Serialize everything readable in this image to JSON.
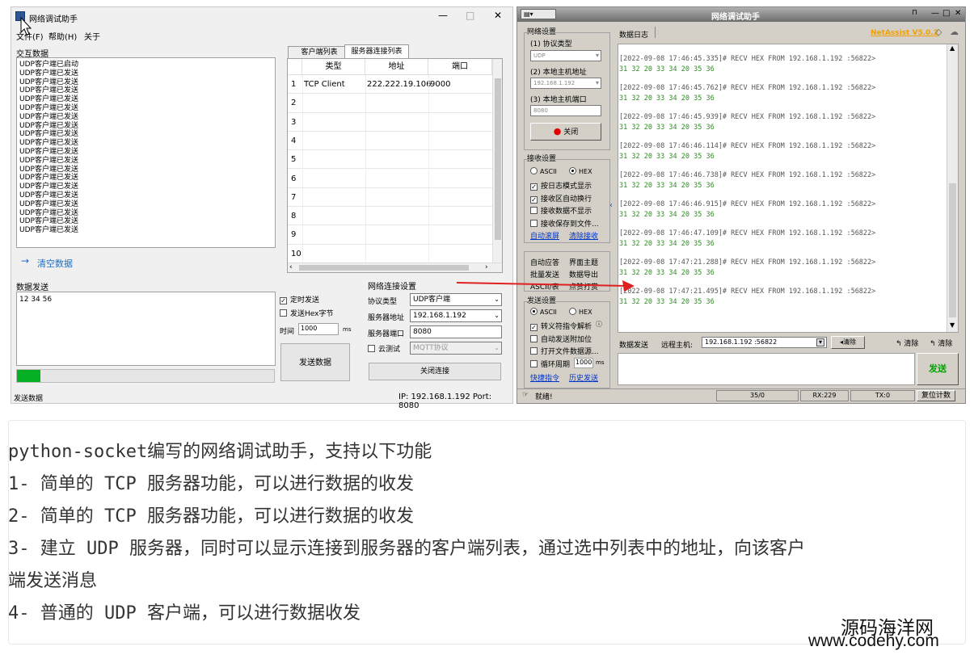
{
  "left_app": {
    "title": "网络调试助手",
    "window_controls": [
      "—",
      "□",
      "✕"
    ],
    "menu": [
      "文件(F)",
      "帮助(H)",
      "关于"
    ],
    "interaction_label": "交互数据",
    "interaction_lines": [
      "UDP客户端已启动",
      "UDP客户端已发送",
      "UDP客户端已发送",
      "UDP客户端已发送",
      "UDP客户端已发送",
      "UDP客户端已发送",
      "UDP客户端已发送",
      "UDP客户端已发送",
      "UDP客户端已发送",
      "UDP客户端已发送",
      "UDP客户端已发送",
      "UDP客户端已发送",
      "UDP客户端已发送",
      "UDP客户端已发送",
      "UDP客户端已发送",
      "UDP客户端已发送",
      "UDP客户端已发送",
      "UDP客户端已发送",
      "UDP客户端已发送",
      "UDP客户端已发送"
    ],
    "tabs": [
      "客户端列表",
      "服务器连接列表"
    ],
    "table_headers": [
      "类型",
      "地址",
      "端口"
    ],
    "rows": [
      {
        "n": "1",
        "type": "TCP Client",
        "addr": "222.222.19.106",
        "port": "9000"
      },
      {
        "n": "2",
        "type": "",
        "addr": "",
        "port": ""
      },
      {
        "n": "3",
        "type": "",
        "addr": "",
        "port": ""
      },
      {
        "n": "4",
        "type": "",
        "addr": "",
        "port": ""
      },
      {
        "n": "5",
        "type": "",
        "addr": "",
        "port": ""
      },
      {
        "n": "6",
        "type": "",
        "addr": "",
        "port": ""
      },
      {
        "n": "7",
        "type": "",
        "addr": "",
        "port": ""
      },
      {
        "n": "8",
        "type": "",
        "addr": "",
        "port": ""
      },
      {
        "n": "9",
        "type": "",
        "addr": "",
        "port": ""
      },
      {
        "n": "10",
        "type": "",
        "addr": "",
        "port": ""
      }
    ],
    "clear_label": "清空数据",
    "send_label": "数据发送",
    "send_text": "12 34 56",
    "timed_send": "定时发送",
    "hex_send": "发送Hex字节",
    "time_label": "时间",
    "time_value": "1000",
    "time_unit": "ms",
    "send_button": "发送数据",
    "progress": 0.09,
    "net_settings_label": "网络连接设置",
    "protocol_label": "协议类型",
    "protocol_value": "UDP客户端",
    "server_addr_label": "服务器地址",
    "server_addr_value": "192.168.1.192",
    "server_port_label": "服务器端口",
    "server_port_value": "8080",
    "cloud_test": "云测试",
    "mqtt_value": "MQTT协议",
    "close_conn": "关闭连接",
    "status_left": "发送数据",
    "status_right": "IP: 192.168.1.192  Port: 8080"
  },
  "right_app": {
    "title": "网络调试助手",
    "window_controls": [
      "—",
      "□",
      "✕"
    ],
    "net_settings": "网络设置",
    "protocol_label": "(1) 协议类型",
    "protocol_value": "UDP",
    "host_label": "(2) 本地主机地址",
    "host_value": "192.168.1.192",
    "port_label": "(3) 本地主机端口",
    "port_value": "8080",
    "close_btn": "关闭",
    "recv_settings": "接收设置",
    "ascii": "ASCII",
    "hex": "HEX",
    "recv_opts": [
      "按日志模式显示",
      "接收区自动换行",
      "接收数据不显示",
      "接收保存到文件..."
    ],
    "recv_checked": [
      true,
      true,
      false,
      false
    ],
    "auto_scroll": "自动滚屏",
    "clear_recv": "清除接收",
    "misc_links": [
      "自动应答",
      "界面主题",
      "批量发送",
      "数据导出",
      "ASCII/表",
      "点赞打赏"
    ],
    "send_settings": "发送设置",
    "send_opts": [
      "转义符指令解析",
      "自动发送附加位",
      "打开文件数据源...",
      "循环周期"
    ],
    "send_checked": [
      true,
      false,
      false,
      false
    ],
    "cycle_value": "1000",
    "cycle_unit": "ms",
    "shortcut": "快捷指令",
    "history": "历史发送",
    "log_tab": "数据日志",
    "brand": "NetAssist V5.0.2",
    "log": [
      {
        "h": "[2022-09-08 17:46:45.335]# RECV HEX FROM 192.168.1.192 :56822>",
        "d": "31 32 20 33 34 20 35 36"
      },
      {
        "h": "[2022-09-08 17:46:45.762]# RECV HEX FROM 192.168.1.192 :56822>",
        "d": "31 32 20 33 34 20 35 36"
      },
      {
        "h": "[2022-09-08 17:46:45.939]# RECV HEX FROM 192.168.1.192 :56822>",
        "d": "31 32 20 33 34 20 35 36"
      },
      {
        "h": "[2022-09-08 17:46:46.114]# RECV HEX FROM 192.168.1.192 :56822>",
        "d": "31 32 20 33 34 20 35 36"
      },
      {
        "h": "[2022-09-08 17:46:46.738]# RECV HEX FROM 192.168.1.192 :56822>",
        "d": "31 32 20 33 34 20 35 36"
      },
      {
        "h": "[2022-09-08 17:46:46.915]# RECV HEX FROM 192.168.1.192 :56822>",
        "d": "31 32 20 33 34 20 35 36"
      },
      {
        "h": "[2022-09-08 17:46:47.109]# RECV HEX FROM 192.168.1.192 :56822>",
        "d": "31 32 20 33 34 20 35 36"
      },
      {
        "h": "[2022-09-08 17:47:21.288]# RECV HEX FROM 192.168.1.192 :56822>",
        "d": "31 32 20 33 34 20 35 36"
      },
      {
        "h": "[2022-09-08 17:47:21.495]# RECV HEX FROM 192.168.1.192 :56822>",
        "d": "31 32 20 33 34 20 35 36"
      }
    ],
    "data_send": "数据发送",
    "remote_host": "远程主机:",
    "remote_value": "192.168.1.192 :56822",
    "clear1": "清除",
    "clear2": "清除",
    "clear3": "清除",
    "send_btn": "发送",
    "status": "就绪!",
    "count": "35/0",
    "rx": "RX:229",
    "tx": "TX:0",
    "reset": "复位计数"
  },
  "description": {
    "lines": [
      "python-socket编写的网络调试助手，支持以下功能",
      "1- 简单的 TCP 服务器功能，可以进行数据的收发",
      "2- 简单的 TCP 服务器功能，可以进行数据的收发",
      "3- 建立 UDP 服务器，同时可以显示连接到服务器的客户端列表，通过选中列表中的地址，向该客户",
      "端发送消息",
      "4- 普通的 UDP 客户端，可以进行数据收发"
    ]
  },
  "watermark": {
    "line1": "源码海洋网",
    "line2": "www.codehy.com"
  }
}
